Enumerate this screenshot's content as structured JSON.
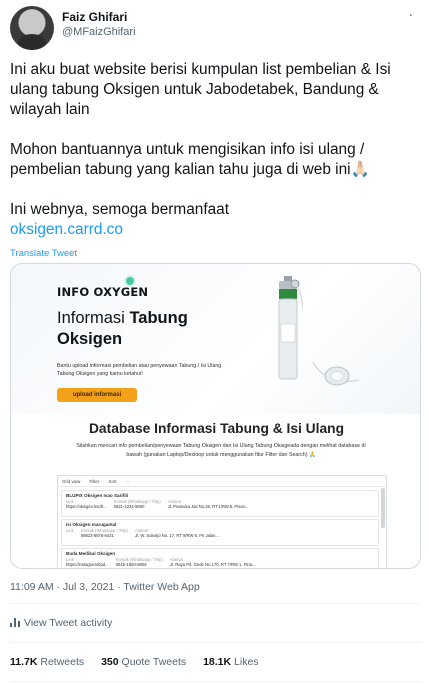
{
  "author": {
    "name": "Faiz Ghifari",
    "handle": "@MFaizGhifari",
    "more": "·"
  },
  "tweet": {
    "line1": "Ini aku buat website berisi kumpulan list pembelian & Isi ulang tabung Oksigen untuk Jabodetabek, Bandung & wilayah lain",
    "line2": "Mohon bantuannya untuk mengisikan info isi ulang / pembelian tabung yang kalian tahu juga di web ini🙏🏻",
    "line3": "Ini webnya, semoga bermanfaat",
    "link": "oksigen.carrd.co",
    "translate": "Translate Tweet"
  },
  "card": {
    "brand": "INFO OXYGEN",
    "title_plain": "Informasi ",
    "title_bold_1": "Tabung",
    "title_bold_2": "Oksigen",
    "desc": "Bantu upload informasi pembelian atau penyewaan Tabung / Isi Ulang Tabung Oksigen yang kamu ketahui!",
    "upload_button": "upload informasi",
    "db_title": "Database Informasi Tabung & Isi Ulang",
    "db_desc": "Silahkan mencari info pembelian/penyewaan Tabung Oksigen dan Isi Ulang Tabung Oksigeada dengan melihat database di bawah (gunakan Laptop/Desktop untuk menggunakan fitur Filter dan Search) 🙏",
    "toolbar": [
      "Grid view",
      "Filter",
      "Sort",
      "···"
    ],
    "rows": [
      {
        "title": "BLUPIX Oksigen Isao Sarifili",
        "c1_lbl": "Link",
        "c1": "https://oksigen.ksoft...",
        "c2_lbl": "Kontak (Whatsapp / Telp)",
        "c2": "0821-1234-5690",
        "c3_lbl": "Alamat",
        "c3": "Jl. Pramuka Jati No.26, RT.1/RW.8, Pisan..."
      },
      {
        "title": "Isi Oksigen marugamal",
        "c1_lbl": "Link",
        "c1": "",
        "c2_lbl": "Kontak (Whatsapp / Telp)",
        "c2": "08823-8876-6431",
        "c3_lbl": "Alamat",
        "c3": "Jl. W. Sukarjo No. 17, RT 9/RW 8, Pri Jalan..."
      },
      {
        "title": "Buda Medikal Oksigen",
        "c1_lbl": "Link",
        "c1": "https://instagram/bpd...",
        "c2_lbl": "Kontak (Whatsapp / Telp)",
        "c2": "0815-1850-5808",
        "c3_lbl": "Alamat",
        "c3": "Jl. Raya Pd. Gede No.170, RT 7/RW 1, Pina..."
      }
    ]
  },
  "meta": {
    "time": "11:09 AM · Jul 3, 2021 · Twitter Web App"
  },
  "activity": {
    "label": "View Tweet activity"
  },
  "stats": {
    "retweets_count": "11.7K",
    "retweets_label": "Retweets",
    "quotes_count": "350",
    "quotes_label": "Quote Tweets",
    "likes_count": "18.1K",
    "likes_label": "Likes"
  },
  "colors": {
    "accent": "#1d9bf0",
    "button": "#f4a11a",
    "secondary_text": "#536471"
  }
}
